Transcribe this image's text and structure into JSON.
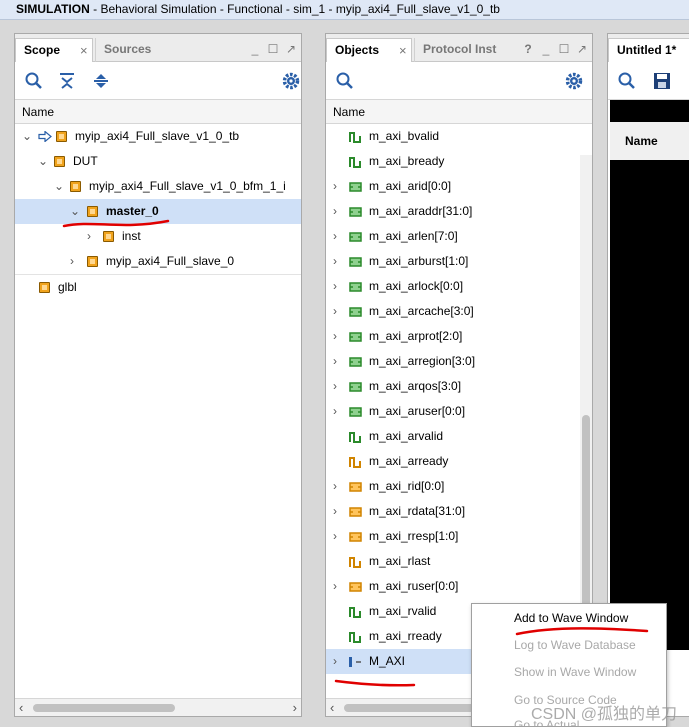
{
  "window": {
    "title_bold": "SIMULATION",
    "title_rest": " - Behavioral Simulation - Functional - sim_1 - myip_axi4_Full_slave_v1_0_tb"
  },
  "scope": {
    "tab_active": "Scope",
    "tab_inactive": "Sources",
    "column": "Name",
    "tree": [
      {
        "label": "myip_axi4_Full_slave_v1_0_tb"
      },
      {
        "label": "DUT"
      },
      {
        "label": "myip_axi4_Full_slave_v1_0_bfm_1_i"
      },
      {
        "label": "master_0"
      },
      {
        "label": "inst"
      },
      {
        "label": "myip_axi4_Full_slave_0"
      },
      {
        "label": "glbl"
      }
    ]
  },
  "objects": {
    "tab_active": "Objects",
    "tab_inactive": "Protocol Inst",
    "column": "Name",
    "rows": [
      {
        "label": "m_axi_bvalid"
      },
      {
        "label": "m_axi_bready"
      },
      {
        "label": "m_axi_arid[0:0]"
      },
      {
        "label": "m_axi_araddr[31:0]"
      },
      {
        "label": "m_axi_arlen[7:0]"
      },
      {
        "label": "m_axi_arburst[1:0]"
      },
      {
        "label": "m_axi_arlock[0:0]"
      },
      {
        "label": "m_axi_arcache[3:0]"
      },
      {
        "label": "m_axi_arprot[2:0]"
      },
      {
        "label": "m_axi_arregion[3:0]"
      },
      {
        "label": "m_axi_arqos[3:0]"
      },
      {
        "label": "m_axi_aruser[0:0]"
      },
      {
        "label": "m_axi_arvalid"
      },
      {
        "label": "m_axi_arready"
      },
      {
        "label": "m_axi_rid[0:0]"
      },
      {
        "label": "m_axi_rdata[31:0]"
      },
      {
        "label": "m_axi_rresp[1:0]"
      },
      {
        "label": "m_axi_rlast"
      },
      {
        "label": "m_axi_ruser[0:0]"
      },
      {
        "label": "m_axi_rvalid"
      },
      {
        "label": "m_axi_rready"
      },
      {
        "label": "M_AXI"
      }
    ]
  },
  "wave": {
    "tab": "Untitled 1*",
    "column": "Name"
  },
  "context_menu": {
    "items": [
      {
        "label": "Add to Wave Window"
      },
      {
        "label": "Log to Wave Database"
      },
      {
        "label": "Show in Wave Window"
      },
      {
        "label": "Go to Source Code"
      },
      {
        "label": "Go to Actual"
      }
    ]
  },
  "watermark": "CSDN @孤独的单刀",
  "icons": [
    "search-icon",
    "collapse-all-icon",
    "expand-all-icon",
    "gear-icon",
    "save-icon",
    "chip-icon",
    "signal-icon",
    "bus-icon",
    "arrow-icon"
  ],
  "colors": {
    "selection": "#cfe0f7",
    "title_bar": "#dfe8f6",
    "chip": "#f0a31d",
    "annotation": "#e00000"
  }
}
